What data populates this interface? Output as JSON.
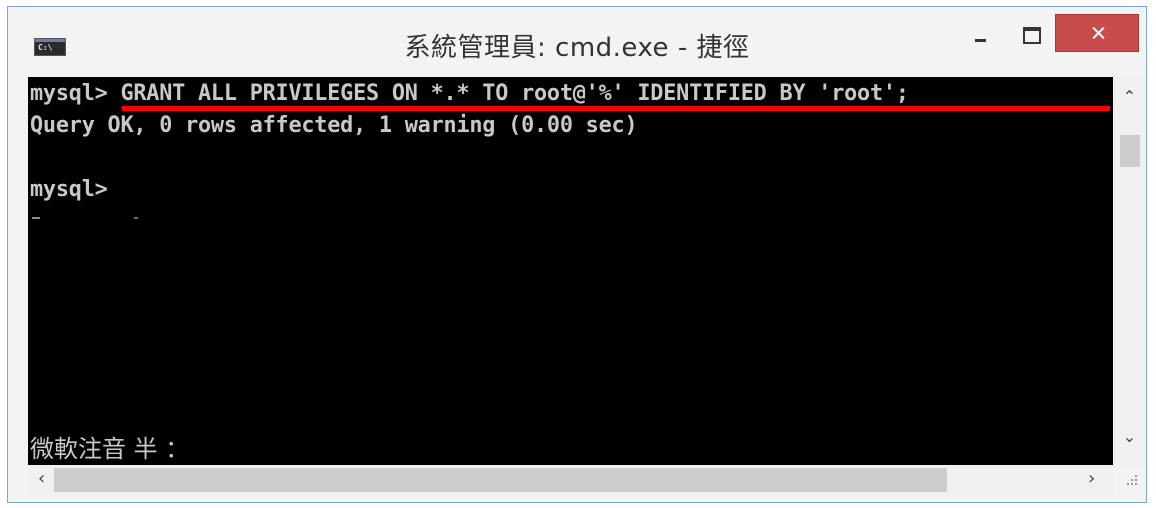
{
  "window": {
    "title": "系統管理員: cmd.exe - 捷徑",
    "icon_text": "C:\\",
    "icons": [
      "cmd-app-icon",
      "minimize-icon",
      "maximize-icon",
      "close-icon"
    ]
  },
  "console": {
    "lines": [
      "mysql> GRANT ALL PRIVILEGES ON *.* TO root@'%' IDENTIFIED BY 'root';",
      "Query OK, 0 rows affected, 1 warning (0.00 sec)",
      "mysql>"
    ],
    "ime_status": "微軟注音 半 ：",
    "highlight_color": "#ff0000",
    "text_color": "#c8c8c8",
    "background": "#000000"
  },
  "scrollbars": {
    "up_arrow": "^",
    "down_arrow": "v",
    "left_arrow": "<",
    "right_arrow": ">"
  },
  "colors": {
    "close_button": "#c74d4d",
    "window_border": "#7aa7d6"
  }
}
